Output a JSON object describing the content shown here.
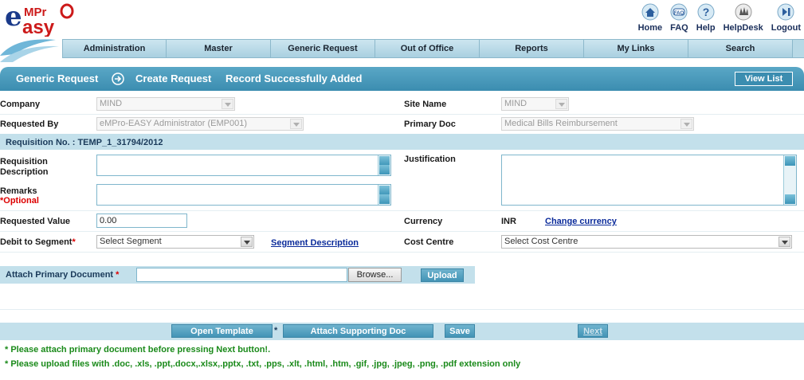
{
  "header": {
    "logo_text": "eMPro easy",
    "links": [
      {
        "label": "Home",
        "icon": "home-icon"
      },
      {
        "label": "FAQ",
        "icon": "faq-icon"
      },
      {
        "label": "Help",
        "icon": "help-icon"
      },
      {
        "label": "HelpDesk",
        "icon": "helpdesk-icon"
      },
      {
        "label": "Logout",
        "icon": "logout-icon"
      }
    ]
  },
  "nav": [
    "Administration",
    "Master",
    "Generic Request",
    "Out of Office",
    "Reports",
    "My Links",
    "Search"
  ],
  "titlebar": {
    "crumb1": "Generic Request",
    "crumb2": "Create Request",
    "message": "Record Successfully Added",
    "view_list": "View List"
  },
  "form": {
    "company_label": "Company",
    "company_value": "MIND",
    "site_label": "Site Name",
    "site_value": "MIND",
    "requested_by_label": "Requested By",
    "requested_by_value": "eMPro-EASY Administrator (EMP001)",
    "primary_doc_label": "Primary Doc",
    "primary_doc_value": "Medical Bills Reimbursement",
    "requisition_no": "Requisition No. : TEMP_1_31794/2012",
    "req_desc_label": "Requisition Description",
    "justification_label": "Justification",
    "remarks_label": "Remarks",
    "remarks_optional": "*Optional",
    "requested_value_label": "Requested Value",
    "requested_value": "0.00",
    "currency_label": "Currency",
    "currency_value": "INR",
    "change_currency": "Change currency",
    "debit_label": "Debit to Segment",
    "debit_value": "Select Segment",
    "segment_desc": "Segment Description",
    "cost_centre_label": "Cost Centre",
    "cost_centre_value": "Select Cost Centre",
    "attach_label": "Attach Primary Document",
    "browse": "Browse...",
    "upload": "Upload"
  },
  "actions": {
    "open_template": "Open Template",
    "attach_supporting": "Attach Supporting Doc",
    "save": "Save",
    "next": "Next"
  },
  "notes": [
    "* Please attach primary document before pressing Next button!.",
    "* Please upload files with .doc, .xls, .ppt,.docx,.xlsx,.pptx, .txt, .pps, .xlt, .html, .htm, .gif, .jpg, .jpeg, .png, .pdf extension only"
  ],
  "colors": {
    "accent": "#3b8db0",
    "band": "#c3e0eb",
    "note": "#1a8a1a",
    "required": "#dd0000"
  }
}
